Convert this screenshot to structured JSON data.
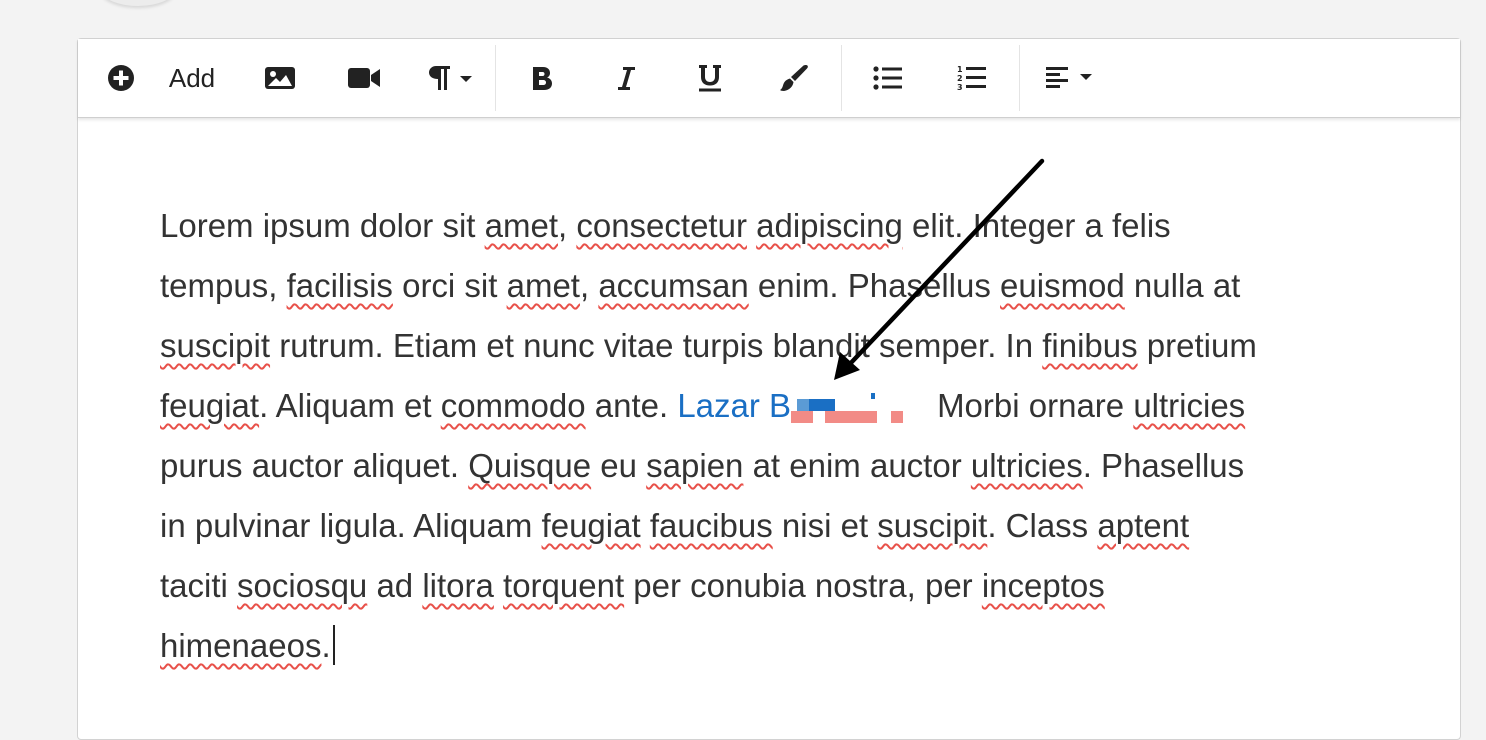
{
  "toolbar": {
    "add_label": "Add",
    "buttons": [
      "add-icon",
      "image-icon",
      "video-icon",
      "paragraph-icon",
      "bold-icon",
      "italic-icon",
      "underline-icon",
      "brush-icon",
      "bullet-list-icon",
      "numbered-list-icon",
      "align-left-icon"
    ]
  },
  "content": {
    "line1_a": "Lorem ipsum dolor sit ",
    "line1_b": "amet",
    "line1_c": ", ",
    "line1_d": "consectetur",
    "line1_e": " ",
    "line1_f": "adipiscing",
    "line1_g": " elit. Integer a felis",
    "line2_a": "tempus, ",
    "line2_b": "facilisis",
    "line2_c": " orci sit ",
    "line2_d": "amet",
    "line2_e": ", ",
    "line2_f": "accumsan",
    "line2_g": " enim. Phasellus ",
    "line2_h": "euismod",
    "line2_i": " nulla at",
    "line3_a": "suscipit",
    "line3_b": " rutrum. Etiam et nunc vitae turpis blandit semper. In ",
    "line3_c": "finibus",
    "line3_d": " pretium",
    "line4_a": "feugiat",
    "line4_b": ". Aliquam et ",
    "line4_c": "commodo",
    "line4_d": " ante. ",
    "mention": "Lazar B",
    "line4_e": "Morbi ornare ",
    "line4_f": "ultricies",
    "line5_a": "purus auctor aliquet. ",
    "line5_b": "Quisque",
    "line5_c": " eu ",
    "line5_d": "sapien",
    "line5_e": " at enim auctor ",
    "line5_f": "ultricies",
    "line5_g": ". Phasellus",
    "line6_a": "in pulvinar ligula. Aliquam ",
    "line6_b": "feugiat",
    "line6_c": " ",
    "line6_d": "faucibus",
    "line6_e": " nisi et ",
    "line6_f": "suscipit",
    "line6_g": ". Class ",
    "line6_h": "aptent",
    "line7_a": "taciti ",
    "line7_b": "sociosqu",
    "line7_c": " ad ",
    "line7_d": "litora",
    "line7_e": " ",
    "line7_f": "torquent",
    "line7_g": " per conubia nostra, per ",
    "line7_h": "inceptos",
    "line8_a": "himenaeos",
    "line8_b": "."
  },
  "colors": {
    "mention": "#1a6fc4",
    "spellcheck": "#e8514a",
    "redaction_blue": "#1a6fc4",
    "redaction_red": "#f28b86"
  }
}
